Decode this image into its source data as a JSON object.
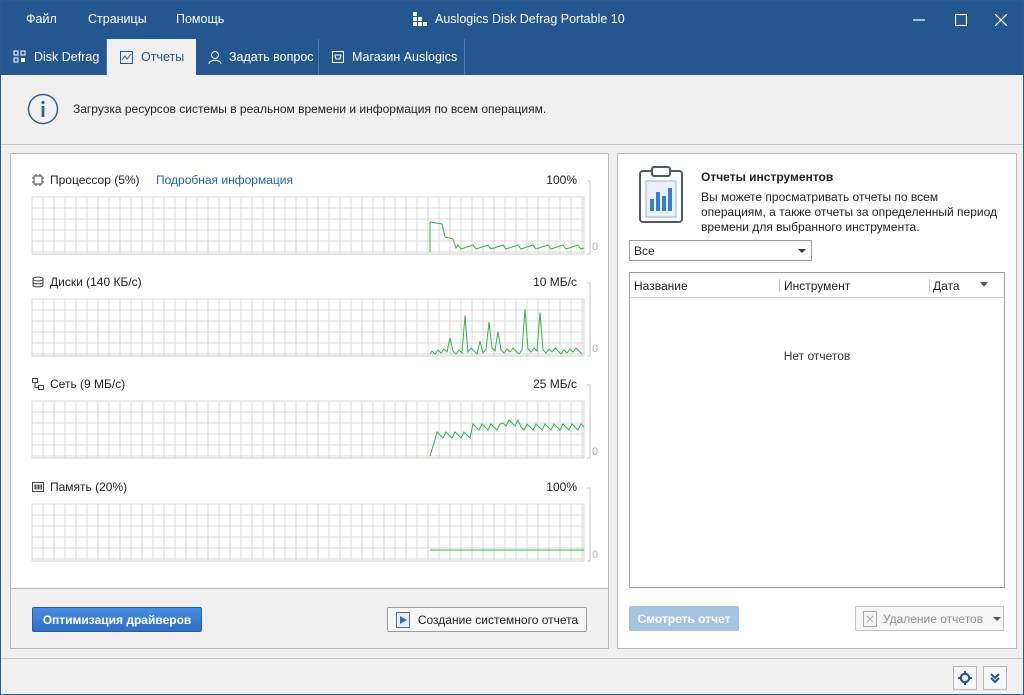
{
  "menu": {
    "file": "Файл",
    "pages": "Страницы",
    "help": "Помощь"
  },
  "app_title": "Auslogics Disk Defrag Portable 10",
  "tabs": [
    {
      "label": "Disk Defrag",
      "icon": "grid-icon"
    },
    {
      "label": "Отчеты",
      "icon": "report-icon",
      "active": true
    },
    {
      "label": "Задать вопрос",
      "icon": "person-icon"
    },
    {
      "label": "Магазин Auslogics",
      "icon": "store-icon"
    }
  ],
  "info": {
    "text": "Загрузка ресурсов системы в реальном времени и информация по всем операциям."
  },
  "metrics": [
    {
      "label": "Процессор (5%)",
      "max": "100%",
      "min": "0",
      "icon": "cpu-icon"
    },
    {
      "label": "Диски (140 КБ/с)",
      "max": "10 МБ/с",
      "min": "0",
      "icon": "disk-icon"
    },
    {
      "label": "Сеть (9 МБ/с)",
      "max": "25 МБ/с",
      "min": "0",
      "icon": "network-icon"
    },
    {
      "label": "Память (20%)",
      "max": "100%",
      "min": "0",
      "icon": "memory-icon"
    }
  ],
  "details_link": "Подробная информация",
  "buttons": {
    "optimize_drivers": "Оптимизация драйверов",
    "create_report": "Создание системного отчета",
    "view_report": "Смотреть отчет",
    "delete_reports": "Удаление отчетов"
  },
  "reports": {
    "title": "Отчеты инструментов",
    "description": "Вы можете просматривать отчеты по всем операциям, а также отчеты за определенный период времени для выбранного инструмента.",
    "filter_value": "Все",
    "columns": [
      "Название",
      "Инструмент",
      "Дата"
    ],
    "empty": "Нет отчетов"
  },
  "colors": {
    "accent": "#24578f",
    "graph_line": "#2fb44a",
    "grid": "#d9d9d9"
  }
}
